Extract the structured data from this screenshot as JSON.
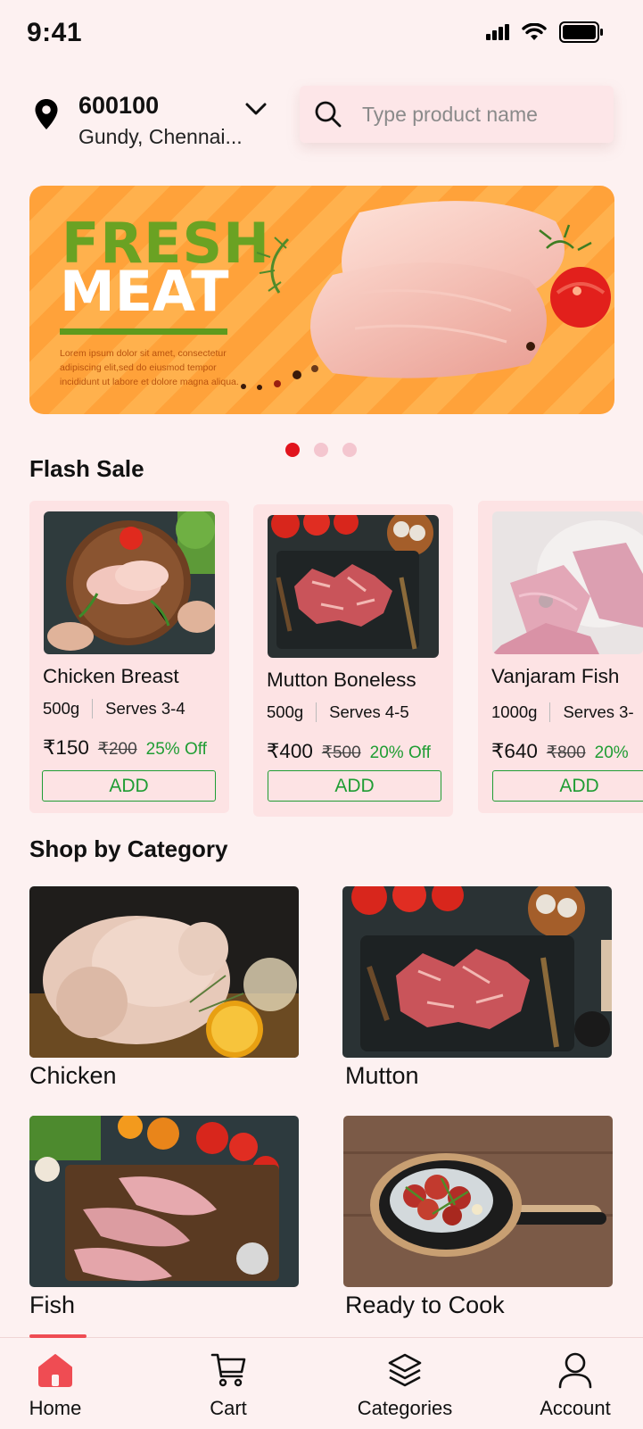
{
  "status": {
    "time": "9:41"
  },
  "location": {
    "pincode": "600100",
    "area": "Gundy, Chennai..."
  },
  "search": {
    "placeholder": "Type product name"
  },
  "banner": {
    "title_line1": "FRESH",
    "title_line2": "MEAT",
    "body": "Lorem ipsum dolor sit amet, consectetur adipiscing elit,sed do eiusmod tempor incididunt ut labore et dolore magna aliqua."
  },
  "carousel": {
    "total": 3,
    "active": 1
  },
  "flash_sale": {
    "title": "Flash Sale",
    "add_label": "ADD",
    "items": [
      {
        "name": "Chicken Breast",
        "weight": "500g",
        "serves": "Serves 3-4",
        "price": "₹150",
        "old_price": "₹200",
        "discount": "25% Off"
      },
      {
        "name": "Mutton Boneless",
        "weight": "500g",
        "serves": "Serves 4-5",
        "price": "₹400",
        "old_price": "₹500",
        "discount": "20% Off"
      },
      {
        "name": "Vanjaram Fish",
        "weight": "1000g",
        "serves": "Serves 3-",
        "price": "₹640",
        "old_price": "₹800",
        "discount": "20%"
      }
    ]
  },
  "categories": {
    "title": "Shop by Category",
    "items": [
      {
        "label": "Chicken"
      },
      {
        "label": "Mutton"
      },
      {
        "label": "Fish"
      },
      {
        "label": "Ready to Cook"
      }
    ]
  },
  "bottom_nav": {
    "active": "Home",
    "items": [
      {
        "label": "Home",
        "icon": "home-icon"
      },
      {
        "label": "Cart",
        "icon": "cart-icon"
      },
      {
        "label": "Categories",
        "icon": "layers-icon"
      },
      {
        "label": "Account",
        "icon": "user-icon"
      }
    ]
  },
  "colors": {
    "accent": "#e1141d",
    "green": "#1f9d33",
    "background": "#fdf1f1",
    "card": "#fde3e4"
  }
}
